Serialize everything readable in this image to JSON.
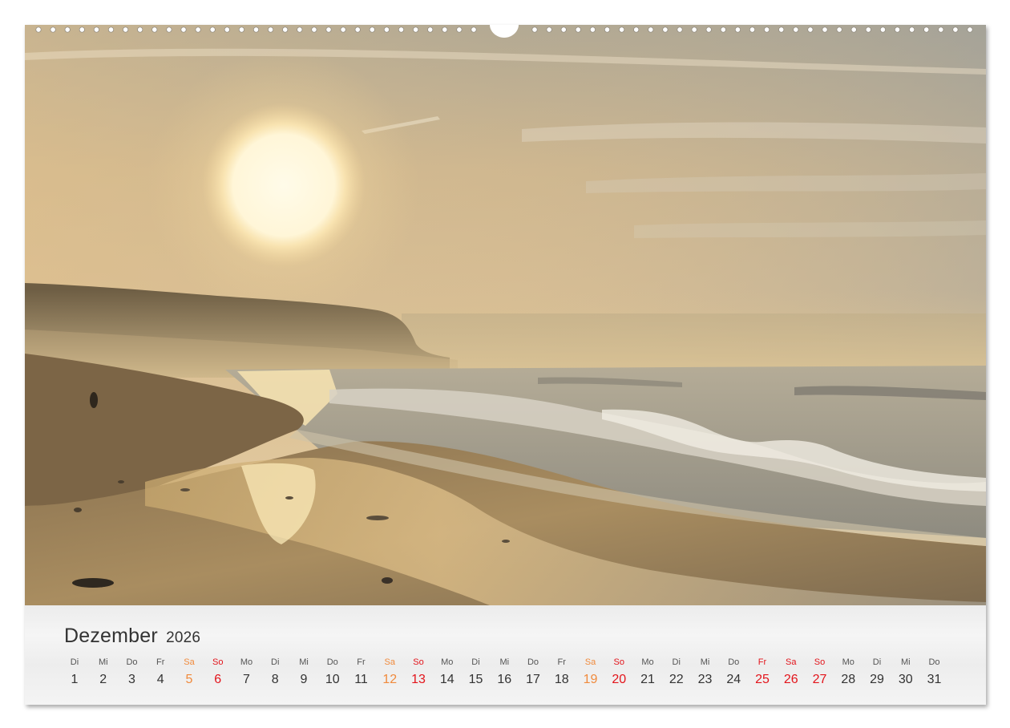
{
  "calendar": {
    "month": "Dezember",
    "year": "2026",
    "days": [
      {
        "wd": "Di",
        "n": "1",
        "t": "wk"
      },
      {
        "wd": "Mi",
        "n": "2",
        "t": "wk"
      },
      {
        "wd": "Do",
        "n": "3",
        "t": "wk"
      },
      {
        "wd": "Fr",
        "n": "4",
        "t": "wk"
      },
      {
        "wd": "Sa",
        "n": "5",
        "t": "sat"
      },
      {
        "wd": "So",
        "n": "6",
        "t": "sun"
      },
      {
        "wd": "Mo",
        "n": "7",
        "t": "wk"
      },
      {
        "wd": "Di",
        "n": "8",
        "t": "wk"
      },
      {
        "wd": "Mi",
        "n": "9",
        "t": "wk"
      },
      {
        "wd": "Do",
        "n": "10",
        "t": "wk"
      },
      {
        "wd": "Fr",
        "n": "11",
        "t": "wk"
      },
      {
        "wd": "Sa",
        "n": "12",
        "t": "sat"
      },
      {
        "wd": "So",
        "n": "13",
        "t": "sun"
      },
      {
        "wd": "Mo",
        "n": "14",
        "t": "wk"
      },
      {
        "wd": "Di",
        "n": "15",
        "t": "wk"
      },
      {
        "wd": "Mi",
        "n": "16",
        "t": "wk"
      },
      {
        "wd": "Do",
        "n": "17",
        "t": "wk"
      },
      {
        "wd": "Fr",
        "n": "18",
        "t": "wk"
      },
      {
        "wd": "Sa",
        "n": "19",
        "t": "sat"
      },
      {
        "wd": "So",
        "n": "20",
        "t": "sun"
      },
      {
        "wd": "Mo",
        "n": "21",
        "t": "wk"
      },
      {
        "wd": "Di",
        "n": "22",
        "t": "wk"
      },
      {
        "wd": "Mi",
        "n": "23",
        "t": "wk"
      },
      {
        "wd": "Do",
        "n": "24",
        "t": "wk"
      },
      {
        "wd": "Fr",
        "n": "25",
        "t": "hol"
      },
      {
        "wd": "Sa",
        "n": "26",
        "t": "hol"
      },
      {
        "wd": "So",
        "n": "27",
        "t": "sun"
      },
      {
        "wd": "Mo",
        "n": "28",
        "t": "wk"
      },
      {
        "wd": "Di",
        "n": "29",
        "t": "wk"
      },
      {
        "wd": "Mi",
        "n": "30",
        "t": "wk"
      },
      {
        "wd": "Do",
        "n": "31",
        "t": "wk"
      }
    ]
  },
  "colors": {
    "saturday": "#f08a3c",
    "sunday_holiday": "#e3141b"
  },
  "photo_subject": "sunset-beach-photo"
}
